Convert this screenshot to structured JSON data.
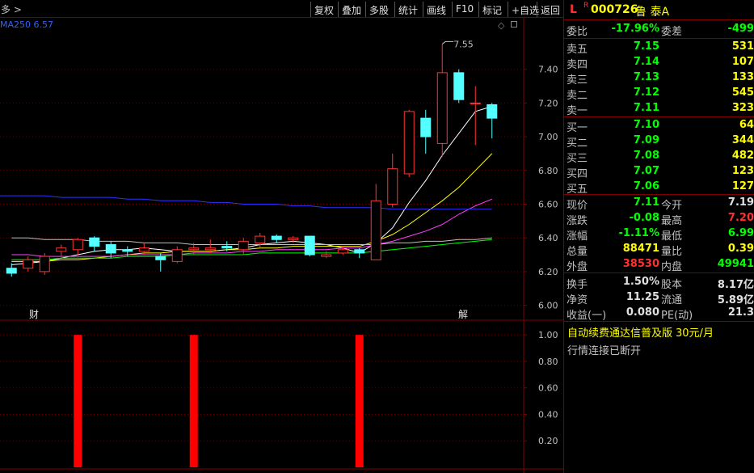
{
  "toolbar": {
    "mode": "多 >",
    "buttons": [
      "复权",
      "叠加",
      "多股",
      "统计",
      "画线",
      "F10",
      "标记",
      "+自选",
      "返回"
    ]
  },
  "ma_label": "MA250  6.57",
  "price_axis": [
    "7.40",
    "7.20",
    "7.00",
    "6.80",
    "6.60",
    "6.40",
    "6.20",
    "6.00"
  ],
  "vol_axis": [
    "1.00",
    "0.80",
    "0.60",
    "0.40",
    "0.20"
  ],
  "high_marker": "7.55",
  "event_markers": {
    "left": "财",
    "right": "解"
  },
  "chart_data": {
    "type": "candlestick",
    "price_range": [
      5.95,
      7.6
    ],
    "candles": [
      {
        "o": 6.22,
        "c": 6.19,
        "h": 6.25,
        "l": 6.17
      },
      {
        "o": 6.22,
        "c": 6.27,
        "h": 6.29,
        "l": 6.2
      },
      {
        "o": 6.2,
        "c": 6.29,
        "h": 6.31,
        "l": 6.18
      },
      {
        "o": 6.32,
        "c": 6.34,
        "h": 6.36,
        "l": 6.29
      },
      {
        "o": 6.33,
        "c": 6.39,
        "h": 6.4,
        "l": 6.3
      },
      {
        "o": 6.4,
        "c": 6.35,
        "h": 6.41,
        "l": 6.32
      },
      {
        "o": 6.36,
        "c": 6.31,
        "h": 6.38,
        "l": 6.28
      },
      {
        "o": 6.33,
        "c": 6.32,
        "h": 6.35,
        "l": 6.29
      },
      {
        "o": 6.32,
        "c": 6.34,
        "h": 6.37,
        "l": 6.3
      },
      {
        "o": 6.29,
        "c": 6.27,
        "h": 6.31,
        "l": 6.2
      },
      {
        "o": 6.26,
        "c": 6.33,
        "h": 6.35,
        "l": 6.25
      },
      {
        "o": 6.33,
        "c": 6.34,
        "h": 6.37,
        "l": 6.3
      },
      {
        "o": 6.33,
        "c": 6.34,
        "h": 6.39,
        "l": 6.31
      },
      {
        "o": 6.35,
        "c": 6.34,
        "h": 6.38,
        "l": 6.32
      },
      {
        "o": 6.33,
        "c": 6.38,
        "h": 6.4,
        "l": 6.3
      },
      {
        "o": 6.37,
        "c": 6.41,
        "h": 6.43,
        "l": 6.34
      },
      {
        "o": 6.41,
        "c": 6.39,
        "h": 6.42,
        "l": 6.37
      },
      {
        "o": 6.39,
        "c": 6.4,
        "h": 6.41,
        "l": 6.37
      },
      {
        "o": 6.41,
        "c": 6.3,
        "h": 6.41,
        "l": 6.29
      },
      {
        "o": 6.29,
        "c": 6.3,
        "h": 6.32,
        "l": 6.28
      },
      {
        "o": 6.31,
        "c": 6.33,
        "h": 6.35,
        "l": 6.3
      },
      {
        "o": 6.33,
        "c": 6.31,
        "h": 6.34,
        "l": 6.28
      },
      {
        "o": 6.27,
        "c": 6.62,
        "h": 6.72,
        "l": 6.27
      },
      {
        "o": 6.6,
        "c": 6.81,
        "h": 6.9,
        "l": 6.58
      },
      {
        "o": 6.78,
        "c": 7.15,
        "h": 7.16,
        "l": 6.76
      },
      {
        "o": 7.11,
        "c": 7.0,
        "h": 7.16,
        "l": 6.9
      },
      {
        "o": 6.96,
        "c": 7.38,
        "h": 7.55,
        "l": 6.88
      },
      {
        "o": 7.38,
        "c": 7.22,
        "h": 7.4,
        "l": 7.2
      },
      {
        "o": 7.2,
        "c": 7.2,
        "h": 7.3,
        "l": 6.95
      },
      {
        "o": 7.19,
        "c": 7.11,
        "h": 7.2,
        "l": 6.99
      }
    ],
    "moving_averages": [
      {
        "name": "MA5",
        "color": "#ffffff",
        "values": [
          6.24,
          6.25,
          6.26,
          6.28,
          6.3,
          6.32,
          6.33,
          6.33,
          6.34,
          6.33,
          6.32,
          6.32,
          6.32,
          6.33,
          6.34,
          6.36,
          6.37,
          6.38,
          6.37,
          6.36,
          6.34,
          6.31,
          6.37,
          6.46,
          6.61,
          6.74,
          6.89,
          7.02,
          7.15,
          7.18
        ]
      },
      {
        "name": "MA10",
        "color": "#ffff00",
        "values": [
          6.26,
          6.26,
          6.26,
          6.27,
          6.27,
          6.28,
          6.29,
          6.3,
          6.31,
          6.31,
          6.32,
          6.32,
          6.32,
          6.33,
          6.33,
          6.34,
          6.34,
          6.35,
          6.35,
          6.35,
          6.35,
          6.35,
          6.38,
          6.42,
          6.48,
          6.55,
          6.62,
          6.7,
          6.8,
          6.9
        ]
      },
      {
        "name": "MA20",
        "color": "#ff40ff",
        "values": [
          6.3,
          6.3,
          6.29,
          6.29,
          6.29,
          6.29,
          6.29,
          6.3,
          6.3,
          6.3,
          6.3,
          6.31,
          6.31,
          6.31,
          6.32,
          6.32,
          6.33,
          6.33,
          6.33,
          6.33,
          6.34,
          6.34,
          6.36,
          6.38,
          6.41,
          6.44,
          6.48,
          6.54,
          6.59,
          6.63
        ]
      },
      {
        "name": "MA60",
        "color": "#00ff00",
        "values": [
          6.27,
          6.27,
          6.27,
          6.28,
          6.28,
          6.28,
          6.28,
          6.29,
          6.29,
          6.29,
          6.3,
          6.3,
          6.3,
          6.3,
          6.3,
          6.31,
          6.31,
          6.31,
          6.31,
          6.31,
          6.31,
          6.31,
          6.32,
          6.33,
          6.34,
          6.35,
          6.36,
          6.37,
          6.38,
          6.39
        ]
      },
      {
        "name": "MA120",
        "color": "#c0c0c0",
        "values": [
          6.4,
          6.4,
          6.39,
          6.39,
          6.39,
          6.38,
          6.38,
          6.38,
          6.37,
          6.37,
          6.37,
          6.36,
          6.36,
          6.36,
          6.36,
          6.36,
          6.36,
          6.36,
          6.36,
          6.36,
          6.36,
          6.36,
          6.36,
          6.37,
          6.37,
          6.38,
          6.38,
          6.39,
          6.39,
          6.4
        ]
      },
      {
        "name": "MA250",
        "color": "#3030ff",
        "values": [
          6.65,
          6.65,
          6.65,
          6.64,
          6.64,
          6.64,
          6.64,
          6.63,
          6.63,
          6.62,
          6.62,
          6.62,
          6.61,
          6.61,
          6.6,
          6.6,
          6.6,
          6.59,
          6.59,
          6.58,
          6.58,
          6.58,
          6.58,
          6.57,
          6.57,
          6.57,
          6.57,
          6.57,
          6.57,
          6.57
        ]
      }
    ],
    "signal_bars": {
      "range": [
        0,
        1.05
      ],
      "values": [
        0,
        0,
        0,
        0,
        1,
        0,
        0,
        0,
        0,
        0,
        0,
        1,
        0,
        0,
        0,
        0,
        0,
        0,
        0,
        0,
        0,
        1,
        0,
        0,
        0,
        0,
        0,
        0,
        0,
        0
      ]
    }
  },
  "quote": {
    "flag": "L",
    "sup": "R",
    "code": "000726",
    "name": "鲁 泰A",
    "weibi_label": "委比",
    "weibi": "-17.96%",
    "weicha_label": "委差",
    "weicha": "-499",
    "asks": [
      {
        "label": "卖五",
        "price": "7.15",
        "vol": "531"
      },
      {
        "label": "卖四",
        "price": "7.14",
        "vol": "107"
      },
      {
        "label": "卖三",
        "price": "7.13",
        "vol": "133"
      },
      {
        "label": "卖二",
        "price": "7.12",
        "vol": "545"
      },
      {
        "label": "卖一",
        "price": "7.11",
        "vol": "323"
      }
    ],
    "bids": [
      {
        "label": "买一",
        "price": "7.10",
        "vol": "64"
      },
      {
        "label": "买二",
        "price": "7.09",
        "vol": "344"
      },
      {
        "label": "买三",
        "price": "7.08",
        "vol": "482"
      },
      {
        "label": "买四",
        "price": "7.07",
        "vol": "123"
      },
      {
        "label": "买五",
        "price": "7.06",
        "vol": "127"
      }
    ],
    "stats": [
      {
        "l1": "现价",
        "v1": "7.11",
        "c1": "green",
        "l2": "今开",
        "v2": "7.19",
        "c2": "white"
      },
      {
        "l1": "涨跌",
        "v1": "-0.08",
        "c1": "green",
        "l2": "最高",
        "v2": "7.20",
        "c2": "red"
      },
      {
        "l1": "涨幅",
        "v1": "-1.11%",
        "c1": "green",
        "l2": "最低",
        "v2": "6.99",
        "c2": "green"
      },
      {
        "l1": "总量",
        "v1": "88471",
        "c1": "yellow",
        "l2": "量比",
        "v2": "0.39",
        "c2": "yellow"
      },
      {
        "l1": "外盘",
        "v1": "38530",
        "c1": "red",
        "l2": "内盘",
        "v2": "49941",
        "c2": "green"
      }
    ],
    "stats2": [
      {
        "l1": "换手",
        "v1": "1.50%",
        "l2": "股本",
        "v2": "8.17亿"
      },
      {
        "l1": "净资",
        "v1": "11.25",
        "l2": "流通",
        "v2": "5.89亿"
      },
      {
        "l1": "收益(一)",
        "v1": "0.080",
        "l2": "PE(动)",
        "v2": "21.3"
      }
    ],
    "promo_text": "自动续费通达信普及版",
    "promo_price": "30元/月",
    "status_text": "行情连接已断开"
  }
}
